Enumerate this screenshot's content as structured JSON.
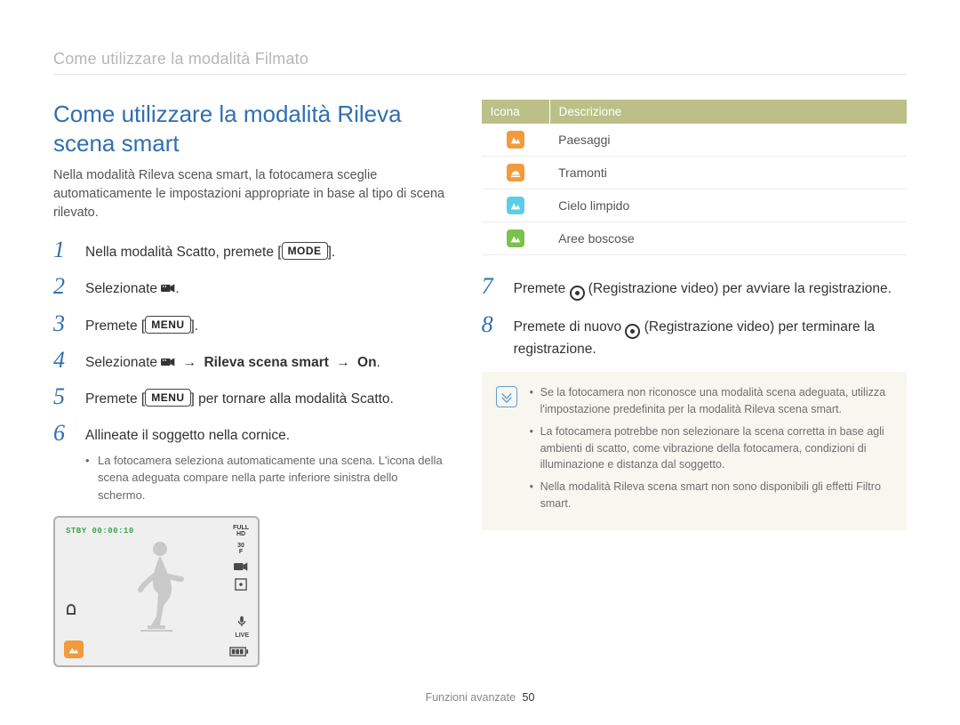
{
  "breadcrumb": "Come utilizzare la modalità Filmato",
  "title": "Come utilizzare la modalità Rileva scena smart",
  "intro": "Nella modalità Rileva scena smart, la fotocamera sceglie automaticamente le impostazioni appropriate in base al tipo di scena rilevato.",
  "buttons": {
    "mode": "MODE",
    "menu": "MENU"
  },
  "steps_1_6": [
    {
      "num": "1",
      "pre": "Nella modalità Scatto, premete [",
      "btn": "mode",
      "post": "]."
    },
    {
      "num": "2",
      "pre": "Selezionate ",
      "icon": "film",
      "post": "."
    },
    {
      "num": "3",
      "pre": "Premete [",
      "btn": "menu",
      "post": "]."
    },
    {
      "num": "4",
      "pre": "Selezionate ",
      "icon": "film",
      "arrow1": " → ",
      "bold1": "Rileva scena smart",
      "arrow2": " → ",
      "bold2": "On",
      "post": "."
    },
    {
      "num": "5",
      "pre": "Premete [",
      "btn": "menu",
      "post": "] per tornare alla modalità Scatto."
    },
    {
      "num": "6",
      "pre": "Allineate il soggetto nella cornice.",
      "note": "La fotocamera seleziona automaticamente una scena. L'icona della scena adeguata compare nella parte inferiore sinistra dello schermo."
    }
  ],
  "steps_7_8": [
    {
      "num": "7",
      "pre": "Premete ",
      "rec": true,
      "post": " (Registrazione video) per avviare la registrazione."
    },
    {
      "num": "8",
      "pre": "Premete di nuovo ",
      "rec": true,
      "post": " (Registrazione video) per terminare la registrazione."
    }
  ],
  "table": {
    "headers": {
      "icon": "Icona",
      "desc": "Descrizione"
    },
    "rows": [
      {
        "color": "si-orange",
        "svg": "mountain",
        "label": "Paesaggi"
      },
      {
        "color": "si-orange",
        "svg": "sunset",
        "label": "Tramonti"
      },
      {
        "color": "si-cyan",
        "svg": "mountain",
        "label": "Cielo limpido"
      },
      {
        "color": "si-green",
        "svg": "mountain",
        "label": "Aree boscose"
      }
    ]
  },
  "notes": [
    "Se la fotocamera non riconosce una modalità scena adeguata, utilizza l'impostazione predefinita per la modalità Rileva scena smart.",
    "La fotocamera potrebbe non selezionare la scena corretta in base agli ambienti di scatto, come vibrazione della fotocamera, condizioni di illuminazione e distanza dal soggetto.",
    "Nella modalità Rileva scena smart non sono disponibili gli effetti Filtro smart."
  ],
  "lcd": {
    "stby": "STBY",
    "time": "00:00:10",
    "fullhd": "FULL\nHD",
    "fps": "30\nF",
    "live": "LIVE"
  },
  "footer": {
    "section": "Funzioni avanzate",
    "page": "50"
  }
}
